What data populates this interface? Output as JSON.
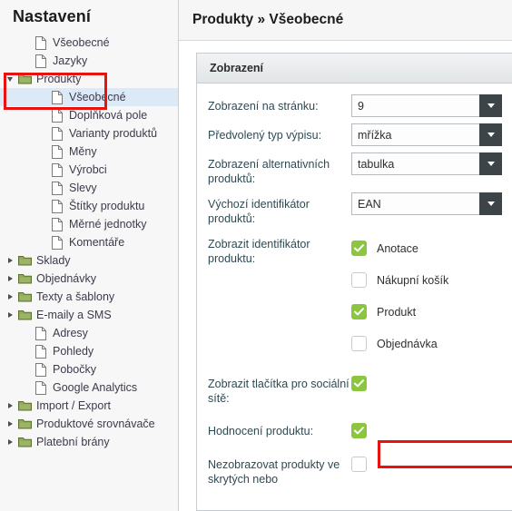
{
  "sidebar": {
    "title": "Nastavení",
    "items": [
      {
        "label": "Všeobecné",
        "icon": "file-icon",
        "indent": 1,
        "twisty": "none",
        "selected": false
      },
      {
        "label": "Jazyky",
        "icon": "file-icon",
        "indent": 1,
        "twisty": "none",
        "selected": false
      },
      {
        "label": "Produkty",
        "icon": "folder-icon",
        "indent": 0,
        "twisty": "expanded",
        "selected": false
      },
      {
        "label": "Všeobecné",
        "icon": "file-icon",
        "indent": 2,
        "twisty": "none",
        "selected": true
      },
      {
        "label": "Doplňková pole",
        "icon": "file-icon",
        "indent": 2,
        "twisty": "none",
        "selected": false
      },
      {
        "label": "Varianty produktů",
        "icon": "file-icon",
        "indent": 2,
        "twisty": "none",
        "selected": false
      },
      {
        "label": "Měny",
        "icon": "file-icon",
        "indent": 2,
        "twisty": "none",
        "selected": false
      },
      {
        "label": "Výrobci",
        "icon": "file-icon",
        "indent": 2,
        "twisty": "none",
        "selected": false
      },
      {
        "label": "Slevy",
        "icon": "file-icon",
        "indent": 2,
        "twisty": "none",
        "selected": false
      },
      {
        "label": "Štítky produktu",
        "icon": "file-icon",
        "indent": 2,
        "twisty": "none",
        "selected": false
      },
      {
        "label": "Měrné jednotky",
        "icon": "file-icon",
        "indent": 2,
        "twisty": "none",
        "selected": false
      },
      {
        "label": "Komentáře",
        "icon": "file-icon",
        "indent": 2,
        "twisty": "none",
        "selected": false
      },
      {
        "label": "Sklady",
        "icon": "folder-icon",
        "indent": 0,
        "twisty": "collapsed",
        "selected": false
      },
      {
        "label": "Objednávky",
        "icon": "folder-icon",
        "indent": 0,
        "twisty": "collapsed",
        "selected": false
      },
      {
        "label": "Texty a šablony",
        "icon": "folder-icon",
        "indent": 0,
        "twisty": "collapsed",
        "selected": false
      },
      {
        "label": "E-maily a SMS",
        "icon": "folder-icon",
        "indent": 0,
        "twisty": "collapsed",
        "selected": false
      },
      {
        "label": "Adresy",
        "icon": "file-icon",
        "indent": 1,
        "twisty": "none",
        "selected": false
      },
      {
        "label": "Pohledy",
        "icon": "file-icon",
        "indent": 1,
        "twisty": "none",
        "selected": false
      },
      {
        "label": "Pobočky",
        "icon": "file-icon",
        "indent": 1,
        "twisty": "none",
        "selected": false
      },
      {
        "label": "Google Analytics",
        "icon": "file-icon",
        "indent": 1,
        "twisty": "none",
        "selected": false
      },
      {
        "label": "Import / Export",
        "icon": "folder-icon",
        "indent": 0,
        "twisty": "collapsed",
        "selected": false
      },
      {
        "label": "Produktové srovnávače",
        "icon": "folder-icon",
        "indent": 0,
        "twisty": "collapsed",
        "selected": false
      },
      {
        "label": "Platební brány",
        "icon": "folder-icon",
        "indent": 0,
        "twisty": "collapsed",
        "selected": false
      }
    ]
  },
  "main": {
    "page_title": "Produkty » Všeobecné",
    "panel_title": "Zobrazení",
    "selects": [
      {
        "label": "Zobrazení na stránku:",
        "value": "9"
      },
      {
        "label": "Předvolený typ výpisu:",
        "value": "mřížka"
      },
      {
        "label": "Zobrazení alternativních produktů:",
        "value": "tabulka"
      },
      {
        "label": "Výchozí identifikátor produktů:",
        "value": "EAN"
      }
    ],
    "identifier_group": {
      "label": "Zobrazit identifikátor produktu:",
      "options": [
        {
          "label": "Anotace",
          "checked": true
        },
        {
          "label": "Nákupní košík",
          "checked": false
        },
        {
          "label": "Produkt",
          "checked": true
        },
        {
          "label": "Objednávka",
          "checked": false
        }
      ]
    },
    "bools": [
      {
        "label": "Zobrazit tlačítka pro sociální sítě:",
        "checked": true
      },
      {
        "label": "Hodnocení produktu:",
        "checked": true
      },
      {
        "label": "Nezobrazovat produkty ve skrytých nebo",
        "checked": false
      }
    ]
  },
  "annotations": {
    "highlight_color": "#e8130f",
    "boxes": [
      {
        "name": "sidebar-produkty-vseobecne-highlight"
      },
      {
        "name": "hodnoceni-produktu-highlight"
      }
    ]
  },
  "colors": {
    "accent_green": "#8cc63f",
    "select_button": "#3c4447",
    "selected_row": "#dceaf7",
    "label_text": "#2f4a52"
  }
}
